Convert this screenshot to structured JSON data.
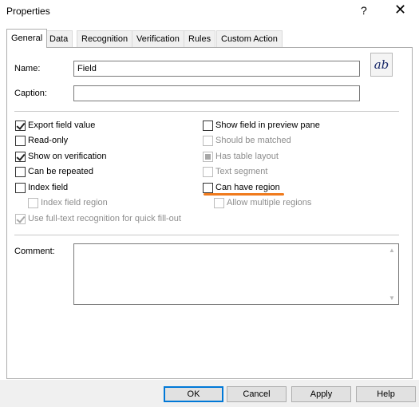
{
  "window": {
    "title": "Properties",
    "help_glyph": "?",
    "close_glyph": "✕"
  },
  "tabs": [
    {
      "label": "General",
      "active": true
    },
    {
      "label": "Data",
      "active": false
    },
    {
      "label": "Recognition",
      "active": false
    },
    {
      "label": "Verification",
      "active": false
    },
    {
      "label": "Rules",
      "active": false
    },
    {
      "label": "Custom Action",
      "active": false
    }
  ],
  "general": {
    "name_label": "Name:",
    "name_value": "Field",
    "caption_label": "Caption:",
    "caption_value": "",
    "format_button_glyph": "ab",
    "left_options": [
      {
        "label": "Export field value",
        "checked": true,
        "enabled": true
      },
      {
        "label": "Read-only",
        "checked": false,
        "enabled": true
      },
      {
        "label": "Show on verification",
        "checked": true,
        "enabled": true
      },
      {
        "label": "Can be repeated",
        "checked": false,
        "enabled": true
      },
      {
        "label": "Index field",
        "checked": false,
        "enabled": true
      },
      {
        "label": "Index field region",
        "checked": false,
        "enabled": false
      },
      {
        "label": "Use full-text recognition for quick fill-out",
        "checked": true,
        "enabled": false
      }
    ],
    "right_options": [
      {
        "label": "Show field in preview pane",
        "checked": false,
        "enabled": true
      },
      {
        "label": "Should be matched",
        "checked": false,
        "enabled": false
      },
      {
        "label": "Has table layout",
        "checked": "indeterminate",
        "enabled": false
      },
      {
        "label": "Text segment",
        "checked": false,
        "enabled": false
      },
      {
        "label": "Can have region",
        "checked": false,
        "enabled": true
      },
      {
        "label": "Allow multiple regions",
        "checked": false,
        "enabled": false
      }
    ],
    "comment_label": "Comment:",
    "comment_value": ""
  },
  "highlight_color": "#f07a1c",
  "buttons": {
    "ok": "OK",
    "cancel": "Cancel",
    "apply": "Apply",
    "help": "Help"
  }
}
